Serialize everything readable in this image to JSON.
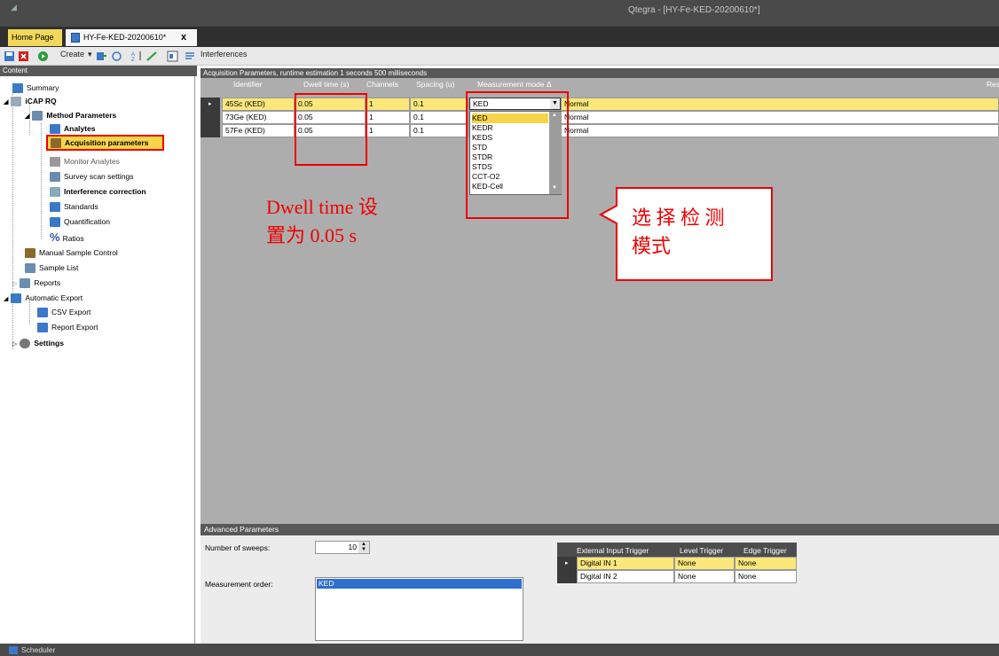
{
  "window": {
    "title": "Qtegra - [HY-Fe-KED-20200610*]"
  },
  "tabs": {
    "home": "Home Page",
    "doc": "HY-Fe-KED-20200610*",
    "close": "x"
  },
  "toolbar": {
    "create": "Create",
    "interferences": "Interferences"
  },
  "content": {
    "header": "Content",
    "tree": [
      {
        "label": "Summary"
      },
      {
        "label": "iCAP RQ"
      },
      {
        "label": "Method Parameters"
      },
      {
        "label": "Analytes"
      },
      {
        "label": "Acquisition parameters"
      },
      {
        "label": "Monitor Analytes"
      },
      {
        "label": "Survey scan settings"
      },
      {
        "label": "Interference correction"
      },
      {
        "label": "Standards"
      },
      {
        "label": "Quantification"
      },
      {
        "label": "Ratios"
      },
      {
        "label": "Manual Sample Control"
      },
      {
        "label": "Sample List"
      },
      {
        "label": "Reports"
      },
      {
        "label": "Automatic Export"
      },
      {
        "label": "CSV Export"
      },
      {
        "label": "Report Export"
      },
      {
        "label": "Settings"
      }
    ]
  },
  "acquisition": {
    "header": "Acquisition Parameters, runtime estimation 1 seconds 500 milliseconds",
    "columns": [
      "Identifier",
      "Dwell time (s)",
      "Channels",
      "Spacing (u)",
      "Measurement mode",
      "Res"
    ],
    "rows": [
      {
        "identifier": "45Sc (KED)",
        "dwell": "0.05",
        "channels": "1",
        "spacing": "0.1",
        "mode": "KED",
        "res": "Normal"
      },
      {
        "identifier": "73Ge (KED)",
        "dwell": "0.05",
        "channels": "1",
        "spacing": "0.1",
        "mode": "",
        "res": "Normal"
      },
      {
        "identifier": "57Fe (KED)",
        "dwell": "0.05",
        "channels": "1",
        "spacing": "0.1",
        "mode": "",
        "res": "Normal"
      }
    ],
    "mode_options": [
      "KED",
      "KEDR",
      "KEDS",
      "STD",
      "STDR",
      "STDS",
      "CCT-O2",
      "KED-Cell"
    ]
  },
  "annotations": {
    "dwell_line1": "Dwell time 设",
    "dwell_line2": "置为 0.05 s",
    "mode_line1": "选 择 检 测",
    "mode_line2": "模式"
  },
  "advanced": {
    "header": "Advanced Parameters",
    "sweeps_label": "Number of sweeps:",
    "sweeps_value": "10",
    "order_label": "Measurement order:",
    "order_items": [
      "KED"
    ],
    "trigger_columns": [
      "External Input Trigger",
      "Level Trigger",
      "Edge Trigger"
    ],
    "trigger_rows": [
      {
        "input": "Digital IN 1",
        "level": "None",
        "edge": "None"
      },
      {
        "input": "Digital IN 2",
        "level": "None",
        "edge": "None"
      }
    ]
  },
  "status": {
    "scheduler": "Scheduler"
  },
  "colors": {
    "selection": "#f7d549",
    "annotation": "#e00000",
    "list_selection": "#2f6fcf"
  }
}
